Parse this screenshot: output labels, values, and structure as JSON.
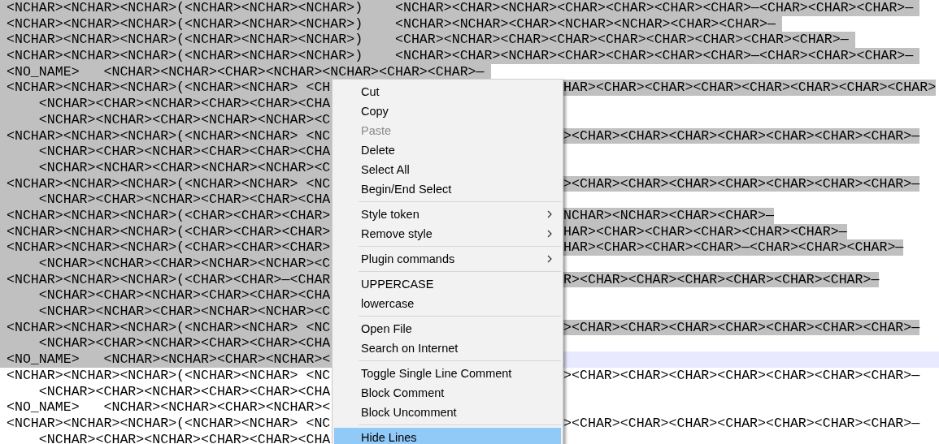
{
  "editor": {
    "lines": [
      {
        "text": "<NCHAR><NCHAR><NCHAR>(<NCHAR><NCHAR><NCHAR>)    <NCHAR><CHAR><NCHAR><CHAR><CHAR><CHAR><CHAR>—<CHAR><CHAR><CHAR>—",
        "selected": true,
        "current": false
      },
      {
        "text": "<NCHAR><NCHAR><NCHAR>(<NCHAR><NCHAR><NCHAR>)    <NCHAR><NCHAR><CHAR><NCHAR><NCHAR><CHAR><CHAR>—",
        "selected": true,
        "current": false
      },
      {
        "text": "<NCHAR><NCHAR><NCHAR>(<NCHAR><NCHAR><NCHAR>)    <CHAR><NCHAR><CHAR><CHAR><CHAR><CHAR><CHAR><CHAR><CHAR>—",
        "selected": true,
        "current": false
      },
      {
        "text": "<NCHAR><NCHAR><NCHAR>(<NCHAR><NCHAR><NCHAR>)    <NCHAR><CHAR><NCHAR><CHAR><CHAR><CHAR><CHAR>—<CHAR><CHAR><CHAR>—",
        "selected": true,
        "current": false
      },
      {
        "text": "<NO_NAME>   <NCHAR><NCHAR><CHAR><NCHAR><NCHAR><CHAR><CHAR>—",
        "selected": true,
        "current": false
      },
      {
        "text": "<NCHAR><NCHAR><NCHAR>(<NCHAR><NCHAR> <CH",
        "text_after_menu": "HAR><CHAR><CHAR><CHAR><CHAR><CHAR><CHAR><CHAR>",
        "selected": true,
        "current": false
      },
      {
        "text": "    <NCHAR><CHAR><NCHAR><CHAR><CHAR><CHA",
        "selected": true,
        "current": false
      },
      {
        "text": "    <NCHAR><NCHAR><CHAR><NCHAR><NCHAR><C",
        "selected": true,
        "current": false
      },
      {
        "text": "<NCHAR><NCHAR><NCHAR>(<NCHAR><NCHAR> <NC",
        "text_after_menu": "><CHAR><CHAR><CHAR><CHAR><CHAR><CHAR><CHAR>—",
        "selected": true,
        "current": false
      },
      {
        "text": "    <NCHAR><CHAR><NCHAR><CHAR><CHAR><CHA",
        "selected": true,
        "current": false
      },
      {
        "text": "    <NCHAR><NCHAR><CHAR><NCHAR><NCHAR><C",
        "selected": true,
        "current": false
      },
      {
        "text": "<NCHAR><NCHAR><NCHAR>(<NCHAR><NCHAR> <NC",
        "text_after_menu": "><CHAR><CHAR><CHAR><CHAR><CHAR><CHAR><CHAR>—",
        "selected": true,
        "current": false
      },
      {
        "text": "    <NCHAR><CHAR><NCHAR><CHAR><CHAR><CHA",
        "selected": true,
        "current": false
      },
      {
        "text": "<NCHAR><NCHAR><NCHAR>(<CHAR><CHAR><CHAR>",
        "text_after_menu": "NCHAR><NCHAR><CHAR><CHAR>—",
        "selected": true,
        "current": false
      },
      {
        "text": "<NCHAR><NCHAR><NCHAR>(<CHAR><CHAR><CHAR>",
        "text_after_menu": "HAR><CHAR><CHAR><CHAR><CHAR><CHAR>—",
        "selected": true,
        "current": false
      },
      {
        "text": "<NCHAR><NCHAR><NCHAR>(<CHAR><CHAR><CHAR>",
        "text_after_menu": "HAR><CHAR><CHAR><CHAR>—<CHAR><CHAR><CHAR>—",
        "selected": true,
        "current": false
      },
      {
        "text": "    <NCHAR><NCHAR><CHAR><NCHAR><NCHAR><C",
        "selected": true,
        "current": false
      },
      {
        "text": "<NCHAR><NCHAR><NCHAR>(<CHAR><CHAR>—<CHAR",
        "text_after_menu": "R><CHAR><CHAR><CHAR><CHAR><CHAR><CHAR>—",
        "selected": true,
        "current": false
      },
      {
        "text": "    <NCHAR><CHAR><NCHAR><CHAR><CHAR><CHA",
        "selected": true,
        "current": false
      },
      {
        "text": "    <NCHAR><NCHAR><CHAR><NCHAR><NCHAR><C",
        "selected": true,
        "current": false
      },
      {
        "text": "<NCHAR><NCHAR><NCHAR>(<NCHAR><NCHAR> <NC",
        "text_after_menu": "><CHAR><CHAR><CHAR><CHAR><CHAR><CHAR><CHAR>—",
        "selected": true,
        "current": false
      },
      {
        "text": "    <NCHAR><CHAR><NCHAR><CHAR><CHAR><CHA",
        "selected": true,
        "current": false
      },
      {
        "text": "<NO_NAME>   <NCHAR><NCHAR><CHAR><NCHAR><",
        "selected": true,
        "current": true
      },
      {
        "text": "<NCHAR><NCHAR><NCHAR>(<NCHAR><NCHAR> <NC",
        "text_after_menu": "><CHAR><CHAR><CHAR><CHAR><CHAR><CHAR><CHAR>—",
        "selected": false,
        "current": false
      },
      {
        "text": "    <NCHAR><CHAR><NCHAR><CHAR><CHAR><CHA",
        "selected": false,
        "current": false
      },
      {
        "text": "<NO_NAME>   <NCHAR><NCHAR><CHAR><NCHAR><",
        "selected": false,
        "current": false
      },
      {
        "text": "<NCHAR><NCHAR><NCHAR>(<NCHAR><NCHAR> <NC",
        "text_after_menu": "><CHAR><CHAR><CHAR><CHAR><CHAR><CHAR><CHAR>—",
        "selected": false,
        "current": false
      },
      {
        "text": "    <NCHAR><CHAR><NCHAR><CHAR><CHAR><CHA",
        "selected": false,
        "current": false
      }
    ]
  },
  "context_menu": {
    "items": [
      {
        "kind": "command",
        "label": "Cut",
        "disabled": false,
        "submenu": false,
        "selected": false
      },
      {
        "kind": "command",
        "label": "Copy",
        "disabled": false,
        "submenu": false,
        "selected": false
      },
      {
        "kind": "command",
        "label": "Paste",
        "disabled": true,
        "submenu": false,
        "selected": false
      },
      {
        "kind": "command",
        "label": "Delete",
        "disabled": false,
        "submenu": false,
        "selected": false
      },
      {
        "kind": "command",
        "label": "Select All",
        "disabled": false,
        "submenu": false,
        "selected": false
      },
      {
        "kind": "command",
        "label": "Begin/End Select",
        "disabled": false,
        "submenu": false,
        "selected": false
      },
      {
        "kind": "separator"
      },
      {
        "kind": "command",
        "label": "Style token",
        "disabled": false,
        "submenu": true,
        "selected": false
      },
      {
        "kind": "command",
        "label": "Remove style",
        "disabled": false,
        "submenu": true,
        "selected": false
      },
      {
        "kind": "separator"
      },
      {
        "kind": "command",
        "label": "Plugin commands",
        "disabled": false,
        "submenu": true,
        "selected": false
      },
      {
        "kind": "separator"
      },
      {
        "kind": "command",
        "label": "UPPERCASE",
        "disabled": false,
        "submenu": false,
        "selected": false
      },
      {
        "kind": "command",
        "label": "lowercase",
        "disabled": false,
        "submenu": false,
        "selected": false
      },
      {
        "kind": "separator"
      },
      {
        "kind": "command",
        "label": "Open File",
        "disabled": false,
        "submenu": false,
        "selected": false
      },
      {
        "kind": "command",
        "label": "Search on Internet",
        "disabled": false,
        "submenu": false,
        "selected": false
      },
      {
        "kind": "separator"
      },
      {
        "kind": "command",
        "label": "Toggle Single Line Comment",
        "disabled": false,
        "submenu": false,
        "selected": false
      },
      {
        "kind": "command",
        "label": "Block Comment",
        "disabled": false,
        "submenu": false,
        "selected": false
      },
      {
        "kind": "command",
        "label": "Block Uncomment",
        "disabled": false,
        "submenu": false,
        "selected": false
      },
      {
        "kind": "separator"
      },
      {
        "kind": "command",
        "label": "Hide Lines",
        "disabled": false,
        "submenu": false,
        "selected": true
      }
    ]
  }
}
